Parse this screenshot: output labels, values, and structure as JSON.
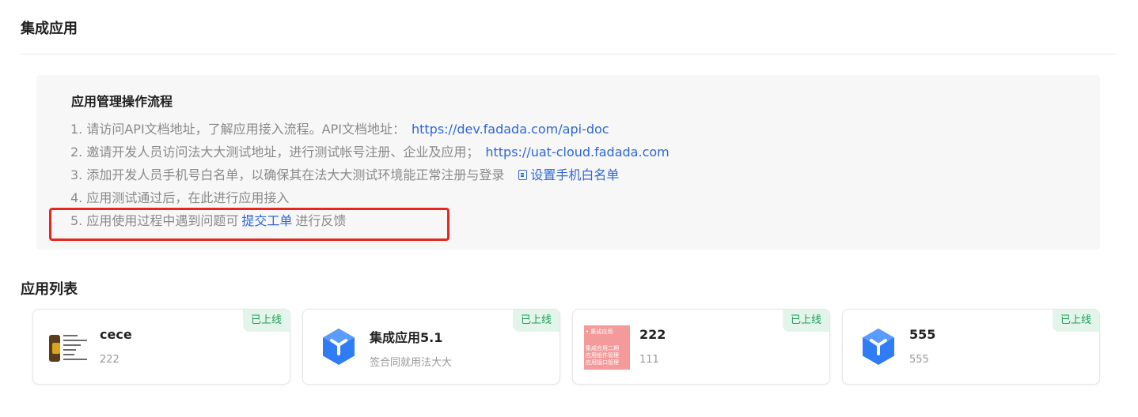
{
  "header": {
    "title": "集成应用"
  },
  "guide": {
    "title": "应用管理操作流程",
    "steps": {
      "s1": {
        "text": "1. 请访问API文档地址，了解应用接入流程。API文档地址：",
        "link": "https://dev.fadada.com/api-doc"
      },
      "s2": {
        "text": "2. 邀请开发人员访问法大大测试地址，进行测试帐号注册、企业及应用；",
        "link": "https://uat-cloud.fadada.com"
      },
      "s3": {
        "text": "3. 添加开发人员手机号白名单，以确保其在法大大测试环境能正常注册与登录",
        "link": "设置手机白名单",
        "icon": "document-icon"
      },
      "s4": {
        "text": "4. 应用测试通过后，在此进行应用接入"
      },
      "s5": {
        "text_before": "5. 应用使用过程中遇到问题可",
        "link": "提交工单",
        "text_after": "进行反馈"
      }
    }
  },
  "app_list": {
    "title": "应用列表",
    "cards": [
      {
        "name": "cece",
        "desc": "222",
        "status": "已上线",
        "logo": "document-thumbnail"
      },
      {
        "name": "集成应用5.1",
        "desc": "签合同就用法大大",
        "status": "已上线",
        "logo": "cube-icon"
      },
      {
        "name": "222",
        "desc": "111",
        "status": "已上线",
        "logo": "poster-thumbnail",
        "logo_text": [
          "• 集成应用",
          "集成应用二期",
          "应用组件管理",
          "应用接口管理"
        ]
      },
      {
        "name": "555",
        "desc": "555",
        "status": "已上线",
        "logo": "cube-icon"
      }
    ]
  },
  "colors": {
    "link": "#2e67d9",
    "highlight": "#e5281f",
    "status_text": "#1f9d55",
    "status_bg": "#e3f5ea",
    "cube_blue": "#2f7cf6"
  }
}
